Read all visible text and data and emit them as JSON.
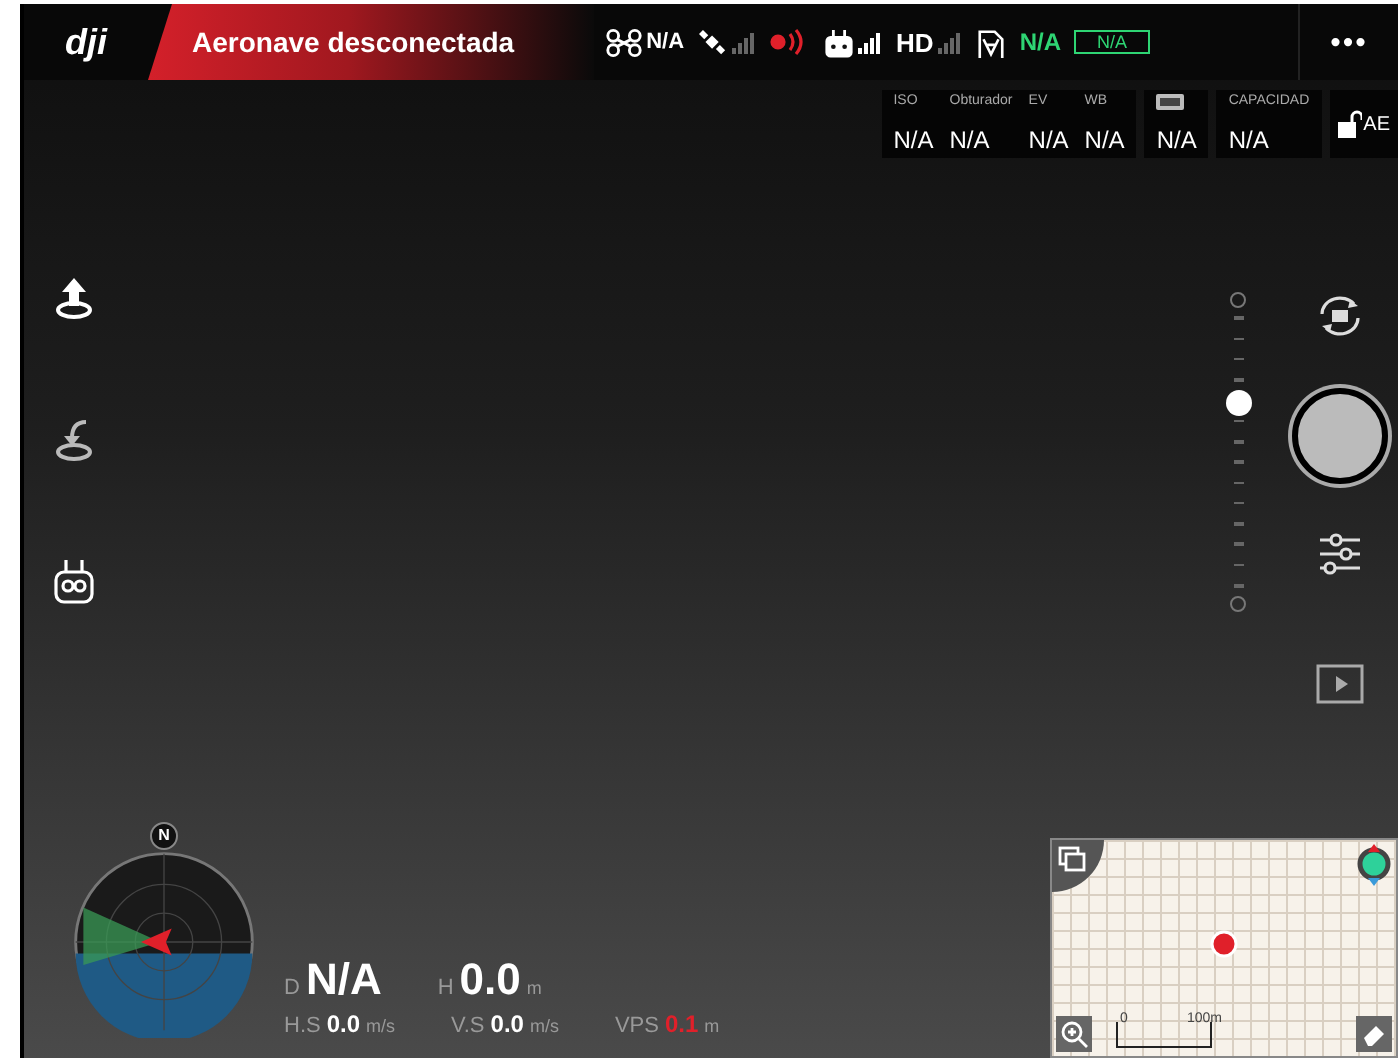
{
  "header": {
    "logo": "dji",
    "title": "Aeronave desconectada",
    "status": [
      {
        "kind": "drone",
        "text": "N/A"
      },
      {
        "kind": "gps",
        "connected": false
      },
      {
        "kind": "rc-alert"
      },
      {
        "kind": "remote",
        "connected": true
      },
      {
        "kind": "hd",
        "text": "HD",
        "connected": false
      },
      {
        "kind": "vision"
      },
      {
        "kind": "green-text",
        "text": "N/A"
      },
      {
        "kind": "battery",
        "text": "N/A"
      }
    ],
    "menu": "•••"
  },
  "camera_params": [
    [
      {
        "label": "ISO",
        "value": "N/A"
      },
      {
        "label": "Obturador",
        "value": "N/A"
      },
      {
        "label": "EV",
        "value": "N/A"
      },
      {
        "label": "WB",
        "value": "N/A"
      }
    ],
    [
      {
        "kind": "format",
        "value": "N/A"
      }
    ],
    [
      {
        "label": "CAPACIDAD",
        "value": "N/A"
      }
    ]
  ],
  "ae_lock": {
    "text": "AE",
    "locked": false
  },
  "left_buttons": [
    {
      "kind": "takeoff"
    },
    {
      "kind": "return-home"
    },
    {
      "kind": "remote"
    }
  ],
  "gimbal": {
    "level": 0.67
  },
  "compass": {
    "north": "N"
  },
  "telemetry": [
    {
      "label": "D",
      "value": "N/A",
      "big": true,
      "alert": false
    },
    {
      "label": "H",
      "value": "0.0",
      "unit": "m",
      "big": true,
      "alert": false
    },
    {
      "label": "H.S",
      "value": "0.0",
      "unit": "m/s",
      "big": false,
      "alert": false
    },
    {
      "label": "V.S",
      "value": "0.0",
      "unit": "m/s",
      "big": false,
      "alert": false
    },
    {
      "label": "VPS",
      "value": "0.1",
      "unit": "m",
      "big": false,
      "alert": true
    }
  ],
  "map": {
    "scale_start": "0",
    "scale_end": "100m"
  }
}
